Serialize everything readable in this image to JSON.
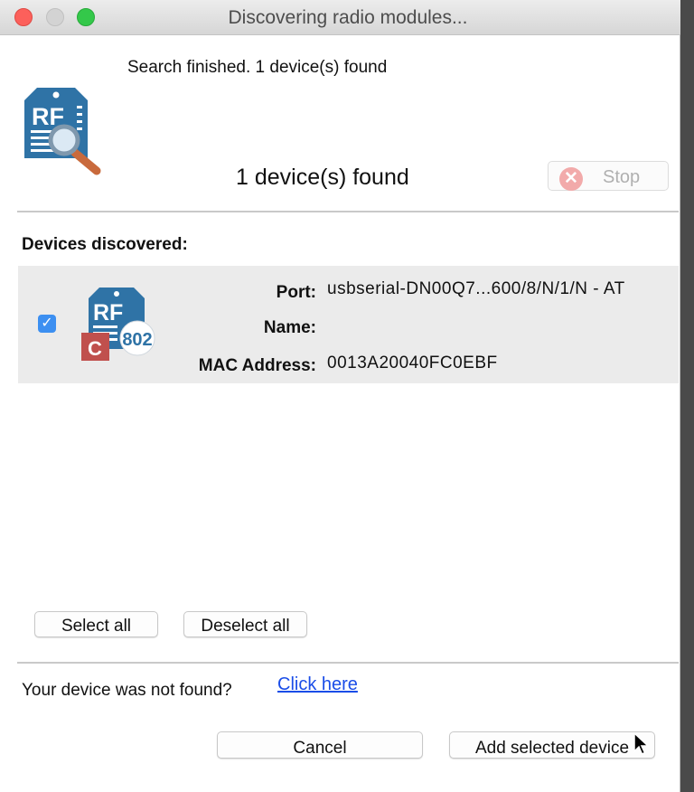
{
  "window": {
    "title": "Discovering radio modules..."
  },
  "status": {
    "message": "Search finished. 1 device(s) found",
    "summary": "1 device(s) found",
    "stop_label": "Stop"
  },
  "devices": {
    "heading": "Devices discovered:",
    "items": [
      {
        "checked": true,
        "icon_text": "RF",
        "badge_letter": "C",
        "badge_number": "802",
        "port_label": "Port:",
        "port_value": "usbserial-DN00Q7...600/8/N/1/N - AT",
        "name_label": "Name:",
        "name_value": "",
        "mac_label": "MAC Address:",
        "mac_value": "0013A20040FC0EBF"
      }
    ]
  },
  "selection": {
    "select_all_label": "Select all",
    "deselect_all_label": "Deselect all"
  },
  "footer": {
    "not_found_text": "Your device was not found?",
    "link_text": "Click here",
    "cancel_label": "Cancel",
    "add_label": "Add selected device"
  },
  "colors": {
    "accent": "#3c8ff1",
    "icon_blue": "#2f73a6",
    "badge_red": "#c0504d",
    "link": "#1a4de8",
    "stop_disabled": "#f2aaaa"
  }
}
